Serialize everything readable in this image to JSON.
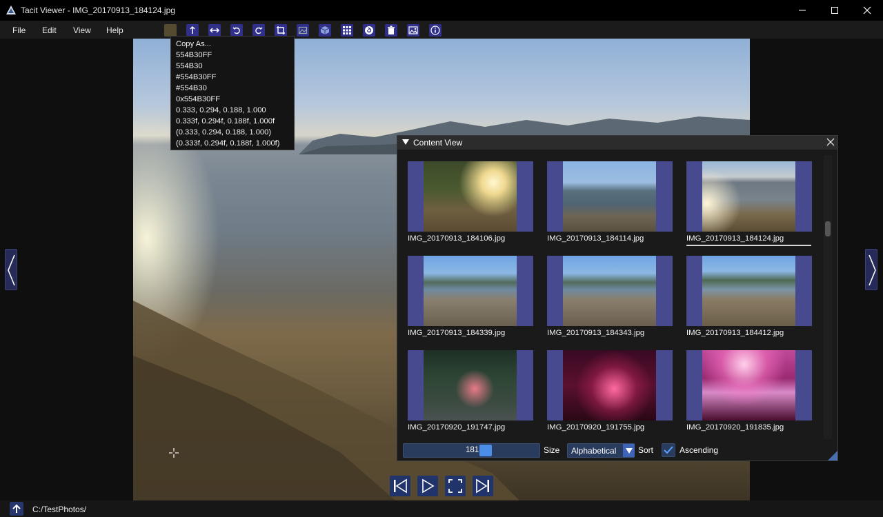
{
  "window": {
    "title": "Tacit Viewer - IMG_20170913_184124.jpg",
    "app_icon": "tacit-viewer-logo-icon",
    "controls": [
      "minimize-icon",
      "maximize-icon",
      "close-icon"
    ]
  },
  "menu": {
    "items": [
      "File",
      "Edit",
      "View",
      "Help"
    ]
  },
  "toolbar": {
    "color_swatch": "#554B30",
    "tools": [
      "flip-vertical-icon",
      "flip-horizontal-icon",
      "rotate-ccw-icon",
      "rotate-cw-icon",
      "crop-icon",
      "image-adjust-icon",
      "cube-icon",
      "grid-icon",
      "refresh-icon",
      "delete-icon",
      "image-icon",
      "info-icon"
    ]
  },
  "copy_menu": {
    "lines": [
      "Copy As...",
      "554B30FF",
      "554B30",
      "#554B30FF",
      "#554B30",
      "0x554B30FF",
      "0.333, 0.294, 0.188, 1.000",
      "0.333f, 0.294f, 0.188f, 1.000f",
      "(0.333, 0.294, 0.188, 1.000)",
      "(0.333f, 0.294f, 0.188f, 1.000f)"
    ]
  },
  "content_view": {
    "title": "Content View",
    "items": [
      "IMG_20170913_184106.jpg",
      "IMG_20170913_184114.jpg",
      "IMG_20170913_184124.jpg",
      "IMG_20170913_184339.jpg",
      "IMG_20170913_184343.jpg",
      "IMG_20170913_184412.jpg",
      "IMG_20170920_191747.jpg",
      "IMG_20170920_191755.jpg",
      "IMG_20170920_191835.jpg"
    ],
    "selected": "IMG_20170913_184124.jpg",
    "size_value": "181",
    "size_label": "Size",
    "sort_value": "Alphabetical",
    "sort_label": "Sort",
    "ascending_label": "Ascending",
    "ascending_checked": true
  },
  "status": {
    "path": "C:/TestPhotos/"
  },
  "colors": {
    "accent": "#4b8ee8",
    "thumb_frame": "#474a8f",
    "swatch": "#554B30"
  }
}
